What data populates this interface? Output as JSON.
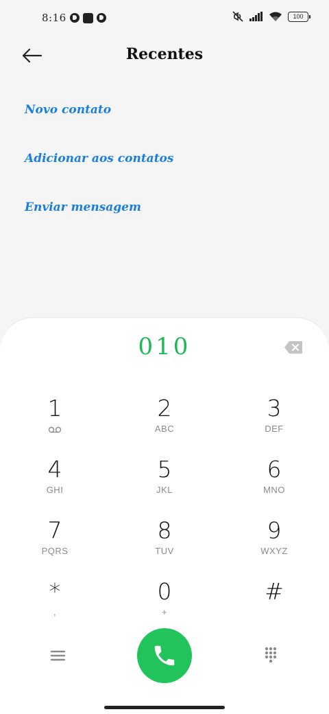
{
  "status_bar": {
    "time": "8:16",
    "battery_level": "100",
    "icons": [
      "notification-app-icon",
      "stop-icon",
      "notification-app-icon",
      "mute-icon",
      "signal-icon",
      "wifi-icon",
      "battery-icon"
    ]
  },
  "header": {
    "title": "Recentes",
    "back_icon": "arrow-left-icon"
  },
  "actions": [
    {
      "label": "Novo contato"
    },
    {
      "label": "Adicionar aos contatos"
    },
    {
      "label": "Enviar mensagem"
    }
  ],
  "dialer": {
    "entered_number": "010",
    "backspace_icon": "backspace-icon",
    "keys": [
      {
        "digit": "1",
        "letters": ""
      },
      {
        "digit": "2",
        "letters": "ABC"
      },
      {
        "digit": "3",
        "letters": "DEF"
      },
      {
        "digit": "4",
        "letters": "GHI"
      },
      {
        "digit": "5",
        "letters": "JKL"
      },
      {
        "digit": "6",
        "letters": "MNO"
      },
      {
        "digit": "7",
        "letters": "PQRS"
      },
      {
        "digit": "8",
        "letters": "TUV"
      },
      {
        "digit": "9",
        "letters": "WXYZ"
      },
      {
        "digit": "*",
        "letters": ","
      },
      {
        "digit": "0",
        "letters": "+"
      },
      {
        "digit": "#",
        "letters": ""
      }
    ],
    "bottom_icons": [
      "menu-icon",
      "phone-call-icon",
      "dialpad-icon"
    ]
  },
  "colors": {
    "accent_link": "#1a7ee0",
    "number_green": "#1db954",
    "call_button": "#21c35a",
    "background": "#f5f5f5"
  }
}
